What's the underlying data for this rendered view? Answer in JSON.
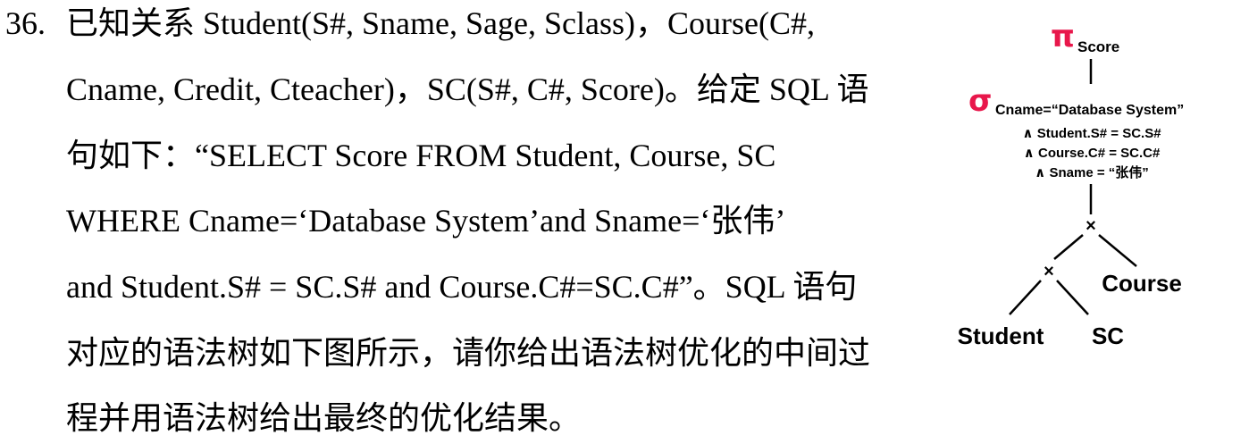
{
  "question": {
    "number": "36.",
    "lines": [
      "已知关系 Student(S#, Sname, Sage, Sclass)，Course(C#,",
      "Cname, Credit, Cteacher)，SC(S#, C#, Score)。给定 SQL 语",
      "句如下：“SELECT Score FROM Student, Course, SC",
      "WHERE Cname=‘Database System’and Sname=‘张伟’",
      "and Student.S# = SC.S# and Course.C#=SC.C#”。SQL 语句",
      "对应的语法树如下图所示，请你给出语法树优化的中间过",
      "程并用语法树给出最终的优化结果。"
    ]
  },
  "syntax_tree": {
    "projection": {
      "symbol": "π",
      "subscript": "Score"
    },
    "selection": {
      "symbol": "σ",
      "conditions": [
        "Cname=“Database System”",
        "∧ Student.S# = SC.S#",
        "∧ Course.C# = SC.C#",
        "∧ Sname = “张伟”"
      ]
    },
    "join_symbol": "×",
    "leaves": {
      "course": "Course",
      "student": "Student",
      "sc": "SC"
    },
    "colors": {
      "operator": "#e8174b",
      "text": "#000000"
    }
  }
}
